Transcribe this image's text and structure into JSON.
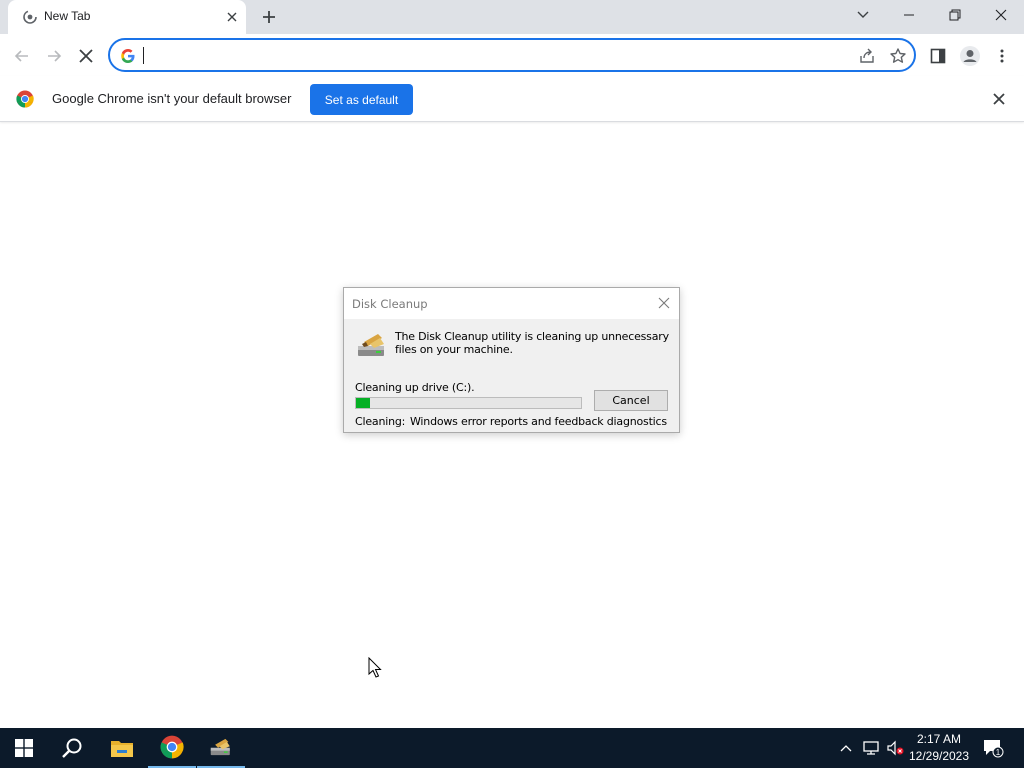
{
  "browser": {
    "tab": {
      "title": "New Tab",
      "favicon": "chrome-loading-icon",
      "close_icon": "close-icon"
    },
    "new_tab_icon": "plus-icon",
    "window_controls": [
      "chevron-down-icon",
      "minimize-icon",
      "restore-icon",
      "close-icon"
    ],
    "toolbar": {
      "back_icon": "back-arrow-icon",
      "forward_icon": "forward-arrow-icon",
      "stop_icon": "stop-loading-icon",
      "omnibox": {
        "value": "",
        "placeholder": "",
        "engine_icon": "google-g-icon"
      },
      "share_icon": "share-icon",
      "bookmark_icon": "star-icon",
      "side_panel_icon": "side-panel-icon",
      "profile_icon": "profile-avatar-icon",
      "menu_icon": "kebab-menu-icon"
    },
    "infobar": {
      "logo": "chrome-logo-icon",
      "message": "Google Chrome isn't your default browser",
      "button_label": "Set as default",
      "close_icon": "close-icon"
    }
  },
  "dialog": {
    "title": "Disk Cleanup",
    "close_icon": "close-icon",
    "icon": "disk-cleanup-icon",
    "message": "The Disk Cleanup utility is cleaning up unnecessary files on your machine.",
    "drive_text": "Cleaning up drive  (C:).",
    "progress_percent": 6,
    "cancel_label": "Cancel",
    "cleaning_label": "Cleaning:",
    "cleaning_value": "Windows error reports and feedback diagnostics"
  },
  "taskbar": {
    "items": [
      "windows-start-icon",
      "search-icon",
      "file-explorer-icon",
      "chrome-icon",
      "disk-cleanup-icon"
    ],
    "tray": [
      "chevron-up-icon",
      "network-icon",
      "volume-muted-icon"
    ],
    "clock_time": "2:17 AM",
    "clock_date": "12/29/2023",
    "notification_count": "1",
    "colors": {
      "taskbar_bg": "#0c1a2a",
      "accent": "#1a73e8",
      "progress": "#06b025"
    }
  }
}
